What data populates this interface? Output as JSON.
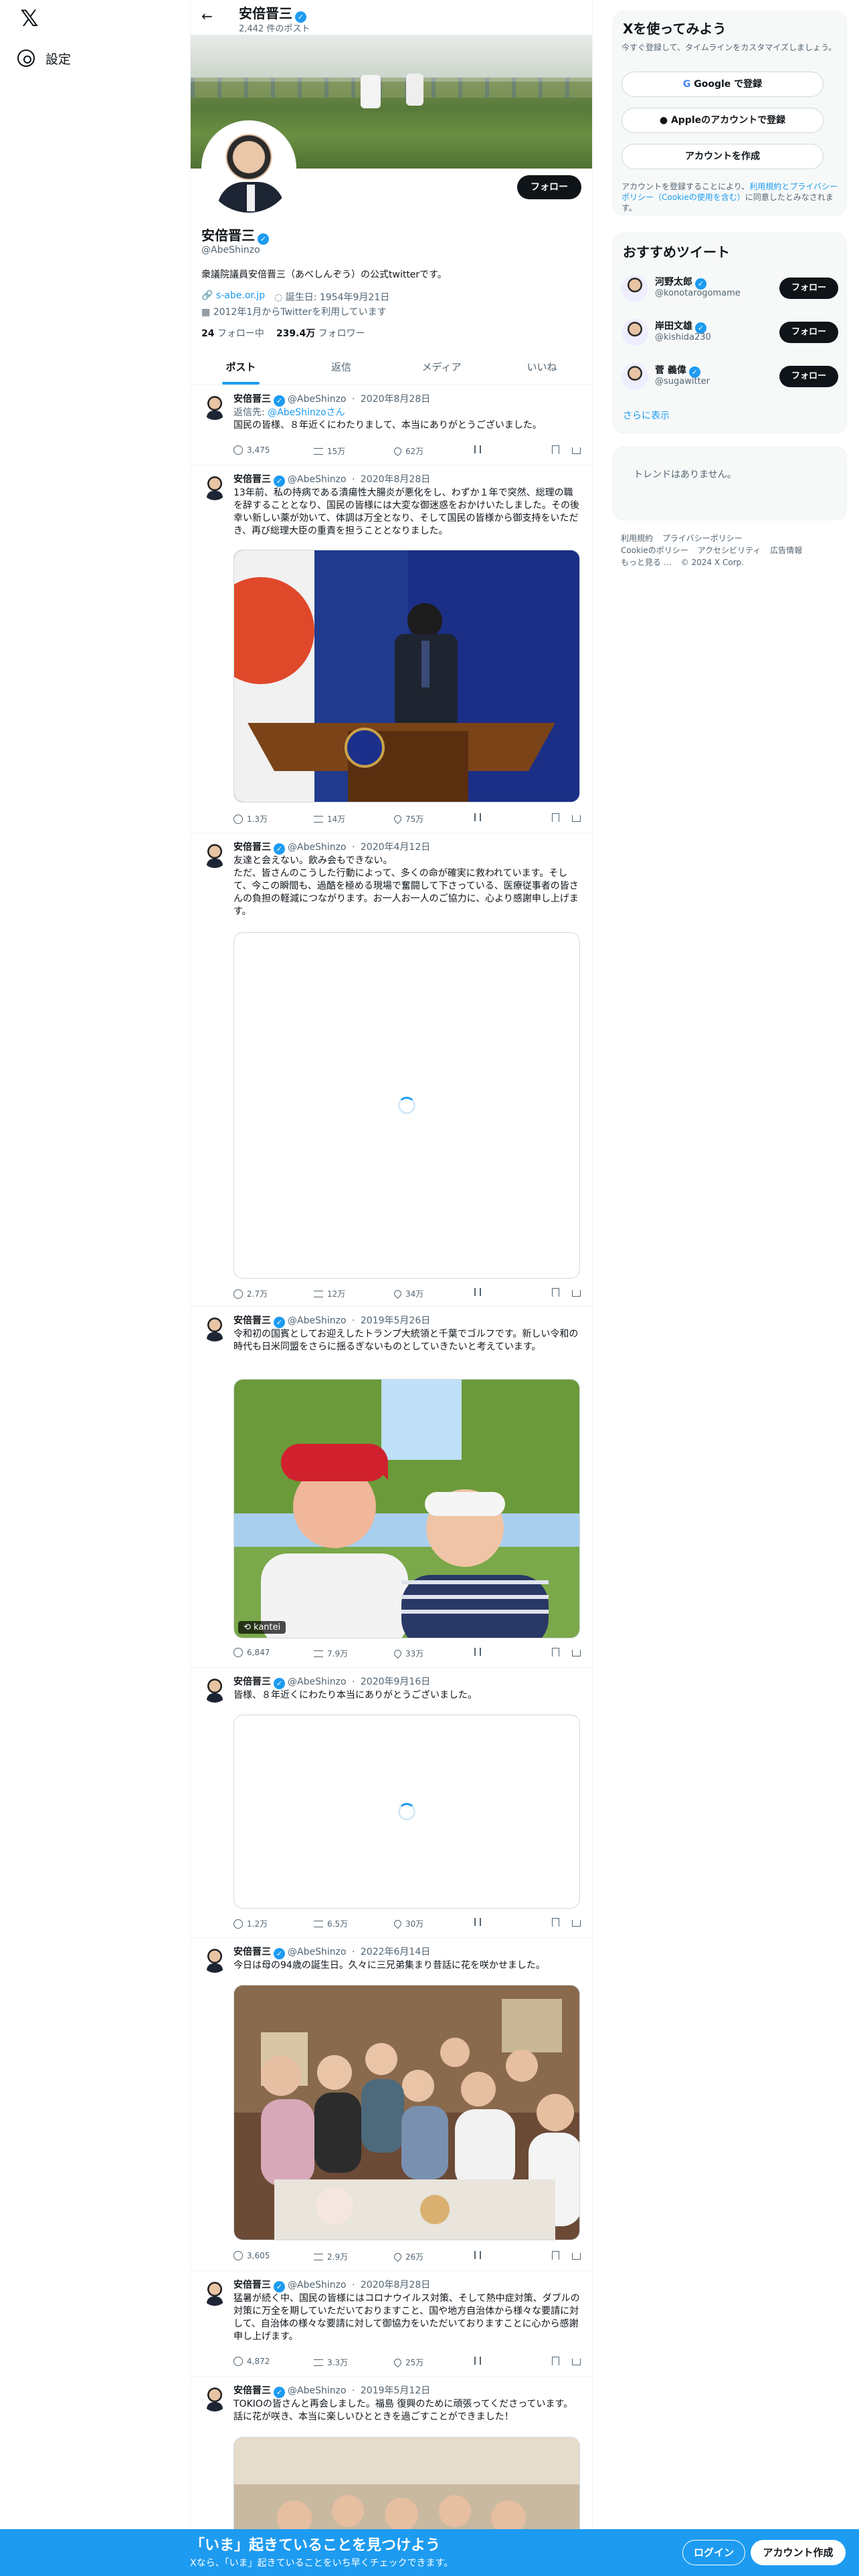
{
  "nav": {
    "logo": "𝕏",
    "settings": "設定"
  },
  "header": {
    "name": "安倍晋三",
    "post_count": "2,442 件のポスト"
  },
  "profile": {
    "name": "安倍晋三",
    "handle": "@AbeShinzo",
    "follow": "フォロー",
    "bio": "衆議院議員安倍晋三（あべしんぞう）の公式twitterです。",
    "website": "s-abe.or.jp",
    "birthday": "誕生日: 1954年9月21日",
    "joined": "2012年1月からTwitterを利用しています",
    "following_count": "24",
    "following_label": "フォロー中",
    "followers_count": "239.4万",
    "followers_label": "フォロワー"
  },
  "tabs": [
    "ポスト",
    "返信",
    "メディア",
    "いいね"
  ],
  "tweets": [
    {
      "name": "安倍晋三",
      "handle": "@AbeShinzo",
      "date": "2020年8月28日",
      "reply_to": "返信先:",
      "reply_handle": "@AbeShinzoさん",
      "text": "国民の皆様、８年近くにわたりまして、本当にありがとうございました。",
      "replies": "3,475",
      "retweets": "15万",
      "likes": "62万"
    },
    {
      "name": "安倍晋三",
      "handle": "@AbeShinzo",
      "date": "2020年8月28日",
      "text": "13年前、私の持病である潰瘍性大腸炎が悪化をし、わずか１年で突然、総理の職を辞することとなり、国民の皆様には大変な御迷惑をおかけいたしました。その後幸い新しい薬が効いて、体調は万全となり、そして国民の皆様から御支持をいただき、再び総理大臣の重責を担うこととなりました。",
      "replies": "1.3万",
      "retweets": "14万",
      "likes": "75万"
    },
    {
      "name": "安倍晋三",
      "handle": "@AbeShinzo",
      "date": "2020年4月12日",
      "text": "友達と会えない。飲み会もできない。\nただ、皆さんのこうした行動によって、多くの命が確実に救われています。そして、今この瞬間も、過酷を極める現場で奮闘して下さっている、医療従事者の皆さんの負担の軽減につながります。お一人お一人のご協力に、心より感謝申し上げます。",
      "replies": "2.7万",
      "retweets": "12万",
      "likes": "34万"
    },
    {
      "name": "安倍晋三",
      "handle": "@AbeShinzo",
      "date": "2019年5月26日",
      "text": "令和初の国賓としてお迎えしたトランプ大統領と千葉でゴルフです。新しい令和の時代も日米同盟をさらに揺るぎないものとしていきたいと考えています。",
      "media_tag": "kantei",
      "replies": "6,847",
      "retweets": "7.9万",
      "likes": "33万"
    },
    {
      "name": "安倍晋三",
      "handle": "@AbeShinzo",
      "date": "2020年9月16日",
      "text": "皆様、８年近くにわたり本当にありがとうございました。",
      "replies": "1.2万",
      "retweets": "6.5万",
      "likes": "30万"
    },
    {
      "name": "安倍晋三",
      "handle": "@AbeShinzo",
      "date": "2022年6月14日",
      "text": "今日は母の94歳の誕生日。久々に三兄弟集まり昔話に花を咲かせました。",
      "replies": "3,605",
      "retweets": "2.9万",
      "likes": "26万"
    },
    {
      "name": "安倍晋三",
      "handle": "@AbeShinzo",
      "date": "2020年8月28日",
      "text": "猛暑が続く中、国民の皆様にはコロナウイルス対策、そして熱中症対策、ダブルの対策に万全を期していただいておりますこと、国や地方自治体から様々な要請に対して、自治体の様々な要請に対して御協力をいただいておりますことに心から感謝申し上げます。",
      "replies": "4,872",
      "retweets": "3.3万",
      "likes": "25万"
    },
    {
      "name": "安倍晋三",
      "handle": "@AbeShinzo",
      "date": "2019年5月12日",
      "text": "TOKIOの皆さんと再会しました。福島 復興のために頑張ってくださっています。話に花が咲き、本当に楽しいひとときを過ごすことができました！"
    }
  ],
  "signup": {
    "title": "Xを使ってみよう",
    "subtitle": "今すぐ登録して、タイムラインをカスタマイズしましょう。",
    "google": "Google で登録",
    "apple": "Appleのアカウントで登録",
    "create": "アカウントを作成",
    "terms_pre": "アカウントを登録することにより、",
    "terms_link": "利用規約とプライバシーポリシー（Cookieの使用を含む）",
    "terms_post": "に同意したとみなされます。"
  },
  "recommend": {
    "title": "おすすめツイート",
    "users": [
      {
        "name": "河野太郎",
        "handle": "@konotarogomame",
        "button": "フォロー"
      },
      {
        "name": "岸田文雄",
        "handle": "@kishida230",
        "button": "フォロー"
      },
      {
        "name": "菅 義偉",
        "handle": "@sugawitter",
        "button": "フォロー"
      }
    ],
    "more": "さらに表示"
  },
  "trends": {
    "empty": "トレンドはありません。"
  },
  "footer": [
    "利用規約",
    "プライバシーポリシー",
    "Cookieのポリシー",
    "アクセシビリティ",
    "広告情報",
    "もっと見る …",
    "© 2024 X Corp."
  ],
  "bottom": {
    "title": "「いま」起きていることを見つけよう",
    "subtitle": "Xなら、「いま」起きていることをいち早くチェックできます。",
    "login": "ログイン",
    "signup": "アカウント作成"
  }
}
